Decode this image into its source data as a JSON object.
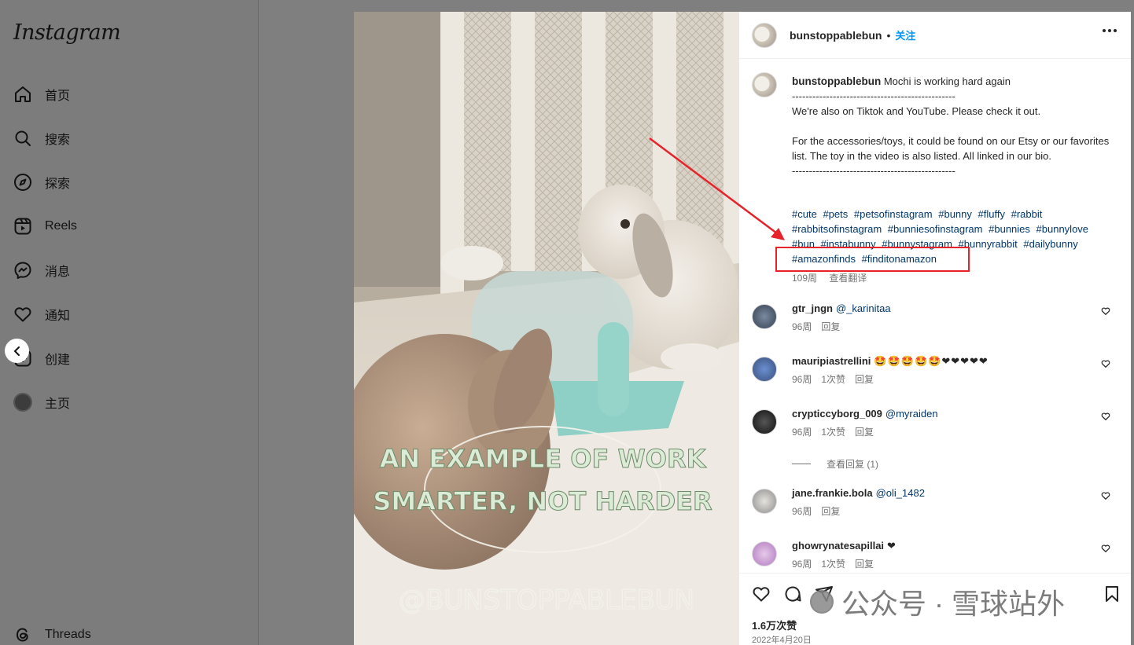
{
  "sidebar": {
    "logo": "Instagram",
    "items": [
      {
        "label": "首页",
        "icon": "home-icon"
      },
      {
        "label": "搜索",
        "icon": "search-icon"
      },
      {
        "label": "探索",
        "icon": "compass-icon"
      },
      {
        "label": "Reels",
        "icon": "reels-icon"
      },
      {
        "label": "消息",
        "icon": "messenger-icon"
      },
      {
        "label": "通知",
        "icon": "heart-icon"
      },
      {
        "label": "创建",
        "icon": "create-icon"
      },
      {
        "label": "主页",
        "icon": "profile-avatar"
      }
    ],
    "threads": "Threads"
  },
  "post": {
    "header": {
      "username": "bunstoppablebun",
      "separator": "•",
      "follow": "关注"
    },
    "caption": {
      "username": "bunstoppablebun",
      "text": " Mochi is working hard again\n------------------------------------------------\nWe're also on Tiktok and YouTube. Please check it out.\n\nFor the accessories/toys, it could be found on our Etsy or our favorites list. The toy in the video is also listed. All linked in our bio.\n------------------------------------------------",
      "hashtags": [
        "#cute",
        "#pets",
        "#petsofinstagram",
        "#bunny",
        "#fluffy",
        "#rabbit",
        "#rabbitsofinstagram",
        "#bunniesofinstagram",
        "#bunnies",
        "#bunnylove",
        "#bun",
        "#instabunny",
        "#bunnystagram",
        "#bunnyrabbit",
        "#dailybunny",
        "#amazonfinds",
        "#finditonamazon"
      ],
      "age": "109周",
      "translate": "查看翻译"
    },
    "comments": [
      {
        "username": "gtr_jngn",
        "mention": "@_karinitaa",
        "emoji": "",
        "age": "96周",
        "likes": "",
        "reply": "回复"
      },
      {
        "username": "mauripiastrellini",
        "mention": "",
        "emoji": "🤩🤩🤩🤩🤩❤❤❤❤❤",
        "age": "96周",
        "likes": "1次赞",
        "reply": "回复"
      },
      {
        "username": "crypticcyborg_009",
        "mention": "@myraiden",
        "emoji": "",
        "age": "96周",
        "likes": "1次赞",
        "reply": "回复"
      },
      {
        "username": "jane.frankie.bola",
        "mention": "@oli_1482",
        "emoji": "",
        "age": "96周",
        "likes": "",
        "reply": "回复"
      },
      {
        "username": "ghowrynatesapillai",
        "mention": "",
        "emoji": "❤",
        "age": "96周",
        "likes": "1次赞",
        "reply": "回复"
      }
    ],
    "view_replies": "查看回复 (1)",
    "likes": "1.6万次赞",
    "date": "2022年4月20日"
  },
  "media": {
    "overlay_line1": "AN EXAMPLE OF WORK",
    "overlay_line2": "SMARTER, NOT HARDER",
    "handle": "@BUNSTOPPABLEBUN"
  },
  "watermark": {
    "text": "公众号 · 雪球站外"
  },
  "colors": {
    "link": "#00376b",
    "follow": "#0095f6",
    "annotation": "#e8222a"
  }
}
